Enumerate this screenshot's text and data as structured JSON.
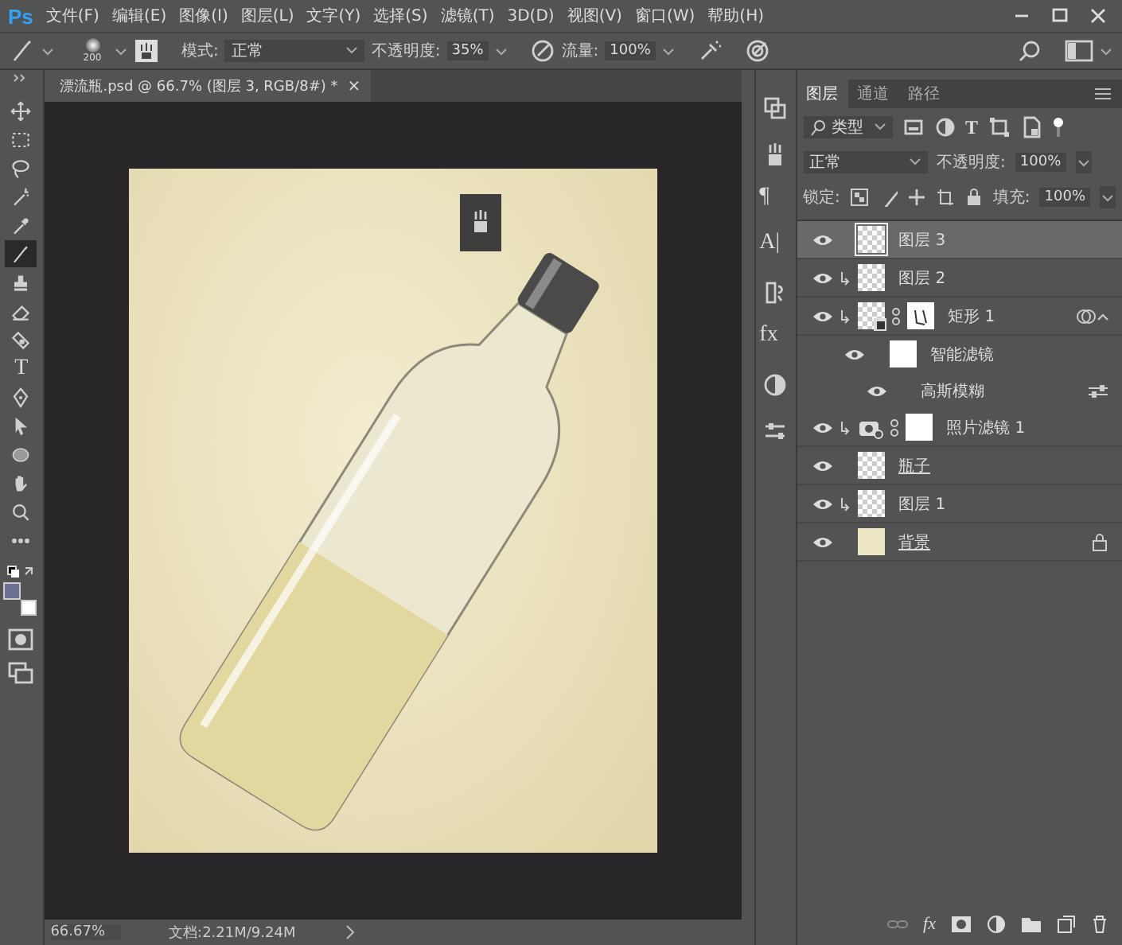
{
  "menu_bar": {
    "logo": "Ps",
    "items": [
      "文件(F)",
      "编辑(E)",
      "图像(I)",
      "图层(L)",
      "文字(Y)",
      "选择(S)",
      "滤镜(T)",
      "3D(D)",
      "视图(V)",
      "窗口(W)",
      "帮助(H)"
    ]
  },
  "options_bar": {
    "brush_size": "200",
    "mode_label": "模式:",
    "mode": "正常",
    "opacity_label": "不透明度:",
    "opacity": "35%",
    "flow_label": "流量:",
    "flow": "100%"
  },
  "document": {
    "tab_title": "漂流瓶.psd @ 66.7% (图层 3, RGB/8#) *",
    "tab_close": "×"
  },
  "tools": [
    {
      "kind": "move",
      "selected": false
    },
    {
      "kind": "marquee",
      "selected": false
    },
    {
      "kind": "lasso",
      "selected": false
    },
    {
      "kind": "wand",
      "selected": false
    },
    {
      "kind": "eyedropper",
      "selected": false
    },
    {
      "kind": "brush",
      "selected": true
    },
    {
      "kind": "stamp",
      "selected": false
    },
    {
      "kind": "eraser",
      "selected": false
    },
    {
      "kind": "smudge",
      "selected": false
    },
    {
      "kind": "text",
      "glyph": "T",
      "selected": false
    },
    {
      "kind": "pen",
      "selected": false
    },
    {
      "kind": "select",
      "selected": false
    },
    {
      "kind": "ellipse",
      "selected": false
    },
    {
      "kind": "hand",
      "selected": false
    },
    {
      "kind": "zoom",
      "selected": false
    },
    {
      "kind": "more",
      "selected": false
    }
  ],
  "swatches": [
    {
      "kind": "foreground",
      "color": "#6d7193"
    },
    {
      "kind": "background",
      "color": "#ffffff"
    }
  ],
  "status_bar": {
    "zoom": "66.67%",
    "doc_info": "文档:2.21M/9.24M"
  },
  "panel_strip": [
    {
      "kind": "history"
    },
    {
      "kind": "brush-settings"
    },
    {
      "kind": "glyph",
      "text": "¶"
    },
    {
      "kind": "glyph",
      "text": "A|"
    },
    {
      "kind": "clone-source"
    },
    {
      "kind": "glyph",
      "text": "fx"
    },
    {
      "kind": "adjustments"
    },
    {
      "kind": "properties"
    }
  ],
  "layers_panel": {
    "tabs": [
      {
        "label": "图层",
        "selected": true
      },
      {
        "label": "通道",
        "selected": false
      },
      {
        "label": "路径",
        "selected": false
      }
    ],
    "filter_label": "类型",
    "filter_text_glyph": "T",
    "blend_mode": "正常",
    "opacity_label": "不透明度:",
    "opacity": "100%",
    "lock_label": "锁定:",
    "fill_label": "填充:",
    "fill": "100%",
    "layers": [
      {
        "name": "图层 3",
        "kind": "pixel",
        "selected": true,
        "visible": true,
        "clipped": false,
        "clip_base": false
      },
      {
        "name": "图层 2",
        "kind": "pixel",
        "selected": false,
        "visible": true,
        "clipped": true,
        "clip_base": false
      },
      {
        "name": "矩形 1",
        "kind": "smart",
        "selected": false,
        "visible": true,
        "clipped": true,
        "clip_base": false,
        "children": [
          {
            "name": "智能滤镜",
            "kind": "filter-mask",
            "visible": true,
            "children": [
              {
                "name": "高斯模糊",
                "kind": "filter",
                "visible": true
              }
            ]
          }
        ]
      },
      {
        "name": "照片滤镜 1",
        "kind": "adjustment",
        "selected": false,
        "visible": true,
        "clipped": true,
        "clip_base": false
      },
      {
        "name": "瓶子",
        "kind": "pixel",
        "selected": false,
        "visible": true,
        "clipped": false,
        "clip_base": true
      },
      {
        "name": "图层 1",
        "kind": "pixel",
        "selected": false,
        "visible": true,
        "clipped": true,
        "clip_base": false
      },
      {
        "name": "背景",
        "kind": "background",
        "selected": false,
        "visible": true,
        "clipped": false,
        "clip_base": true
      }
    ],
    "footer_fx": "fx"
  }
}
